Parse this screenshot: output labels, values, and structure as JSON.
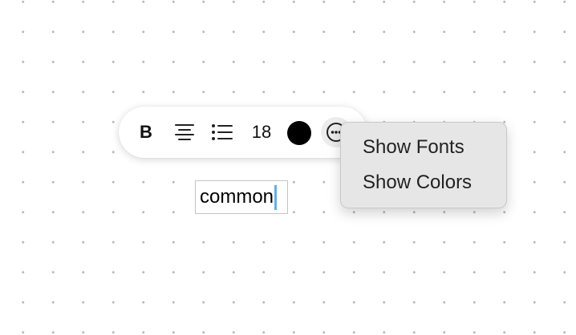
{
  "toolbar": {
    "bold_label": "B",
    "font_size": "18",
    "current_color": "#000000",
    "icons": [
      "align-center-icon",
      "bulleted-list-icon",
      "color-swatch",
      "more-options-icon"
    ]
  },
  "textbox": {
    "text": "common"
  },
  "context_menu": {
    "items": [
      {
        "label": "Show Fonts"
      },
      {
        "label": "Show Colors"
      }
    ]
  },
  "colors": {
    "caret": "#5fb0e8",
    "menu_background": "#e6e6e6",
    "canvas_dots": "#b9b9b9"
  }
}
